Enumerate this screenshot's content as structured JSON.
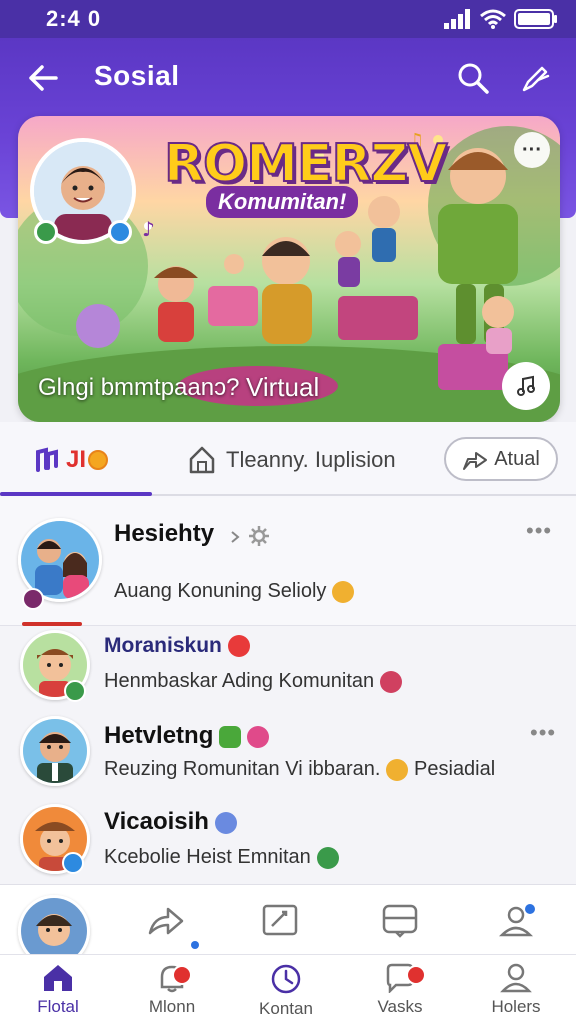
{
  "status": {
    "time": "2:4 0"
  },
  "app": {
    "title": "Sosial"
  },
  "hero": {
    "title": "ROMERZV",
    "subtitle": "Komumitan!",
    "caption_left": "Glngi bmmtpaanɔ?",
    "caption_right": "Virtual"
  },
  "tabs": [
    {
      "label": "JI",
      "icon": "music-note-icon"
    },
    {
      "label": "Tleanny. Iuplision",
      "icon": "home-icon"
    },
    {
      "label": "Atual",
      "icon": "share-icon"
    }
  ],
  "feed": [
    {
      "name": "Hesiehty",
      "text": "Auang Konuning Selioly",
      "has_more": true
    },
    {
      "name": "Moraniskun",
      "text": "Henmbaskar Ading Komunitan",
      "has_more": false
    },
    {
      "name": "Hetvletng",
      "text": "Reuzing Romunitan Vi ibbaran.",
      "text_extra": "Pesiadial",
      "has_more": true
    },
    {
      "name": "Vicaoisih",
      "text": "Kcebolie Heist Emnitan",
      "has_more": false
    }
  ],
  "nav": [
    {
      "label": "Flotal",
      "icon": "home-icon",
      "active": true
    },
    {
      "label": "Mlonn",
      "icon": "notification-icon",
      "active": false
    },
    {
      "label": "Kontan",
      "icon": "clock-icon",
      "active": false
    },
    {
      "label": "Vasks",
      "icon": "chat-icon",
      "active": false
    },
    {
      "label": "Holers",
      "icon": "profile-icon",
      "active": false
    }
  ],
  "colors": {
    "primary": "#5b37c4",
    "status_bar": "#4a30a6",
    "accent_red": "#e0312f"
  }
}
